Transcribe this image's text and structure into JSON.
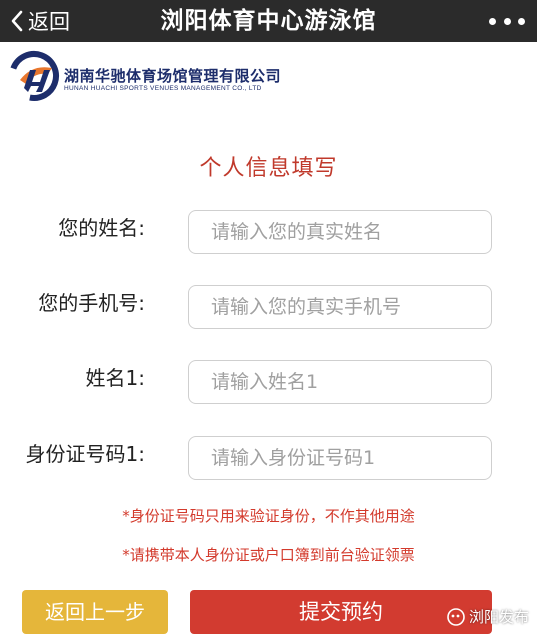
{
  "header": {
    "back_label": "返回",
    "title": "浏阳体育中心游泳馆"
  },
  "logo": {
    "name_cn": "湖南华驰体育场馆管理有限公司",
    "name_en": "HUNAN HUACHI SPORTS VENUES MANAGEMENT CO., LTD"
  },
  "form": {
    "title": "个人信息填写",
    "fields": [
      {
        "label": "您的姓名:",
        "value": "",
        "placeholder": "请输入您的真实姓名"
      },
      {
        "label": "您的手机号:",
        "value": "",
        "placeholder": "请输入您的真实手机号"
      },
      {
        "label": "姓名1:",
        "value": "",
        "placeholder": "请输入姓名1"
      },
      {
        "label": "身份证号码1:",
        "value": "",
        "placeholder": "请输入身份证号码1"
      }
    ],
    "notes": [
      "*身份证号码只用来验证身份，不作其他用途",
      "*请携带本人身份证或户口簿到前台验证领票"
    ]
  },
  "buttons": {
    "back_label": "返回上一步",
    "submit_label": "提交预约"
  },
  "watermark": {
    "text": "浏阳发布"
  },
  "colors": {
    "topbar": "#2b2b2b",
    "accent_red": "#d23b30",
    "back_button": "#e5b63a",
    "logo_navy": "#1d2d6b",
    "logo_orange": "#e8772e"
  }
}
